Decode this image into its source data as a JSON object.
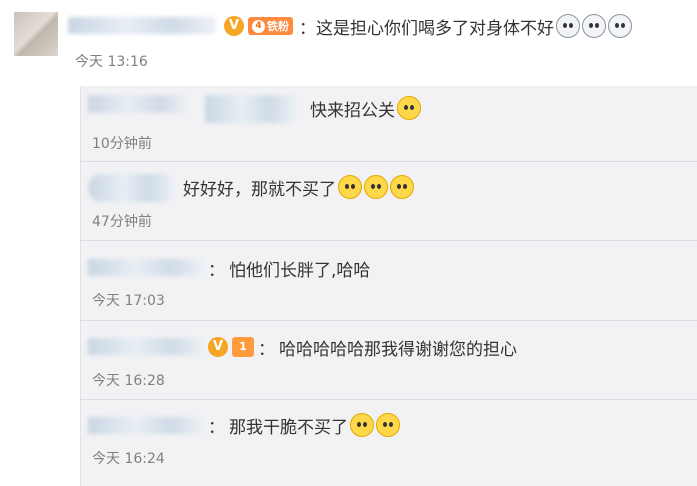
{
  "main_comment": {
    "colon": "：",
    "text": "这是担心你们喝多了对身体不好",
    "badge_v": "V",
    "fan_badge_level": "4",
    "fan_badge_text": "铁粉",
    "time": "今天 13:16",
    "emojis": [
      "husky-icon",
      "husky-icon",
      "husky-icon"
    ]
  },
  "replies": [
    {
      "text": "快来招公关",
      "time": "10分钟前",
      "emojis": [
        "doge-icon"
      ]
    },
    {
      "text": "好好好，那就不买了",
      "time": "47分钟前",
      "emojis": [
        "doge-icon",
        "doge-icon",
        "doge-icon"
      ]
    },
    {
      "colon": "：",
      "text": "怕他们长胖了,哈哈",
      "time": "今天 17:03",
      "emojis": []
    },
    {
      "colon": "：",
      "text": "哈哈哈哈哈那我得谢谢您的担心",
      "time": "今天 16:28",
      "badge_v": "V",
      "level_badge": "1",
      "emojis": []
    },
    {
      "colon": "：",
      "text": "那我干脆不买了",
      "time": "今天 16:24",
      "emojis": [
        "doge-icon",
        "doge-icon"
      ]
    }
  ],
  "colors": {
    "panel_bg": "#f2f2f5",
    "badge_orange": "#f5a623",
    "fan_badge": "#ff8a3d",
    "time_gray": "#808080"
  }
}
